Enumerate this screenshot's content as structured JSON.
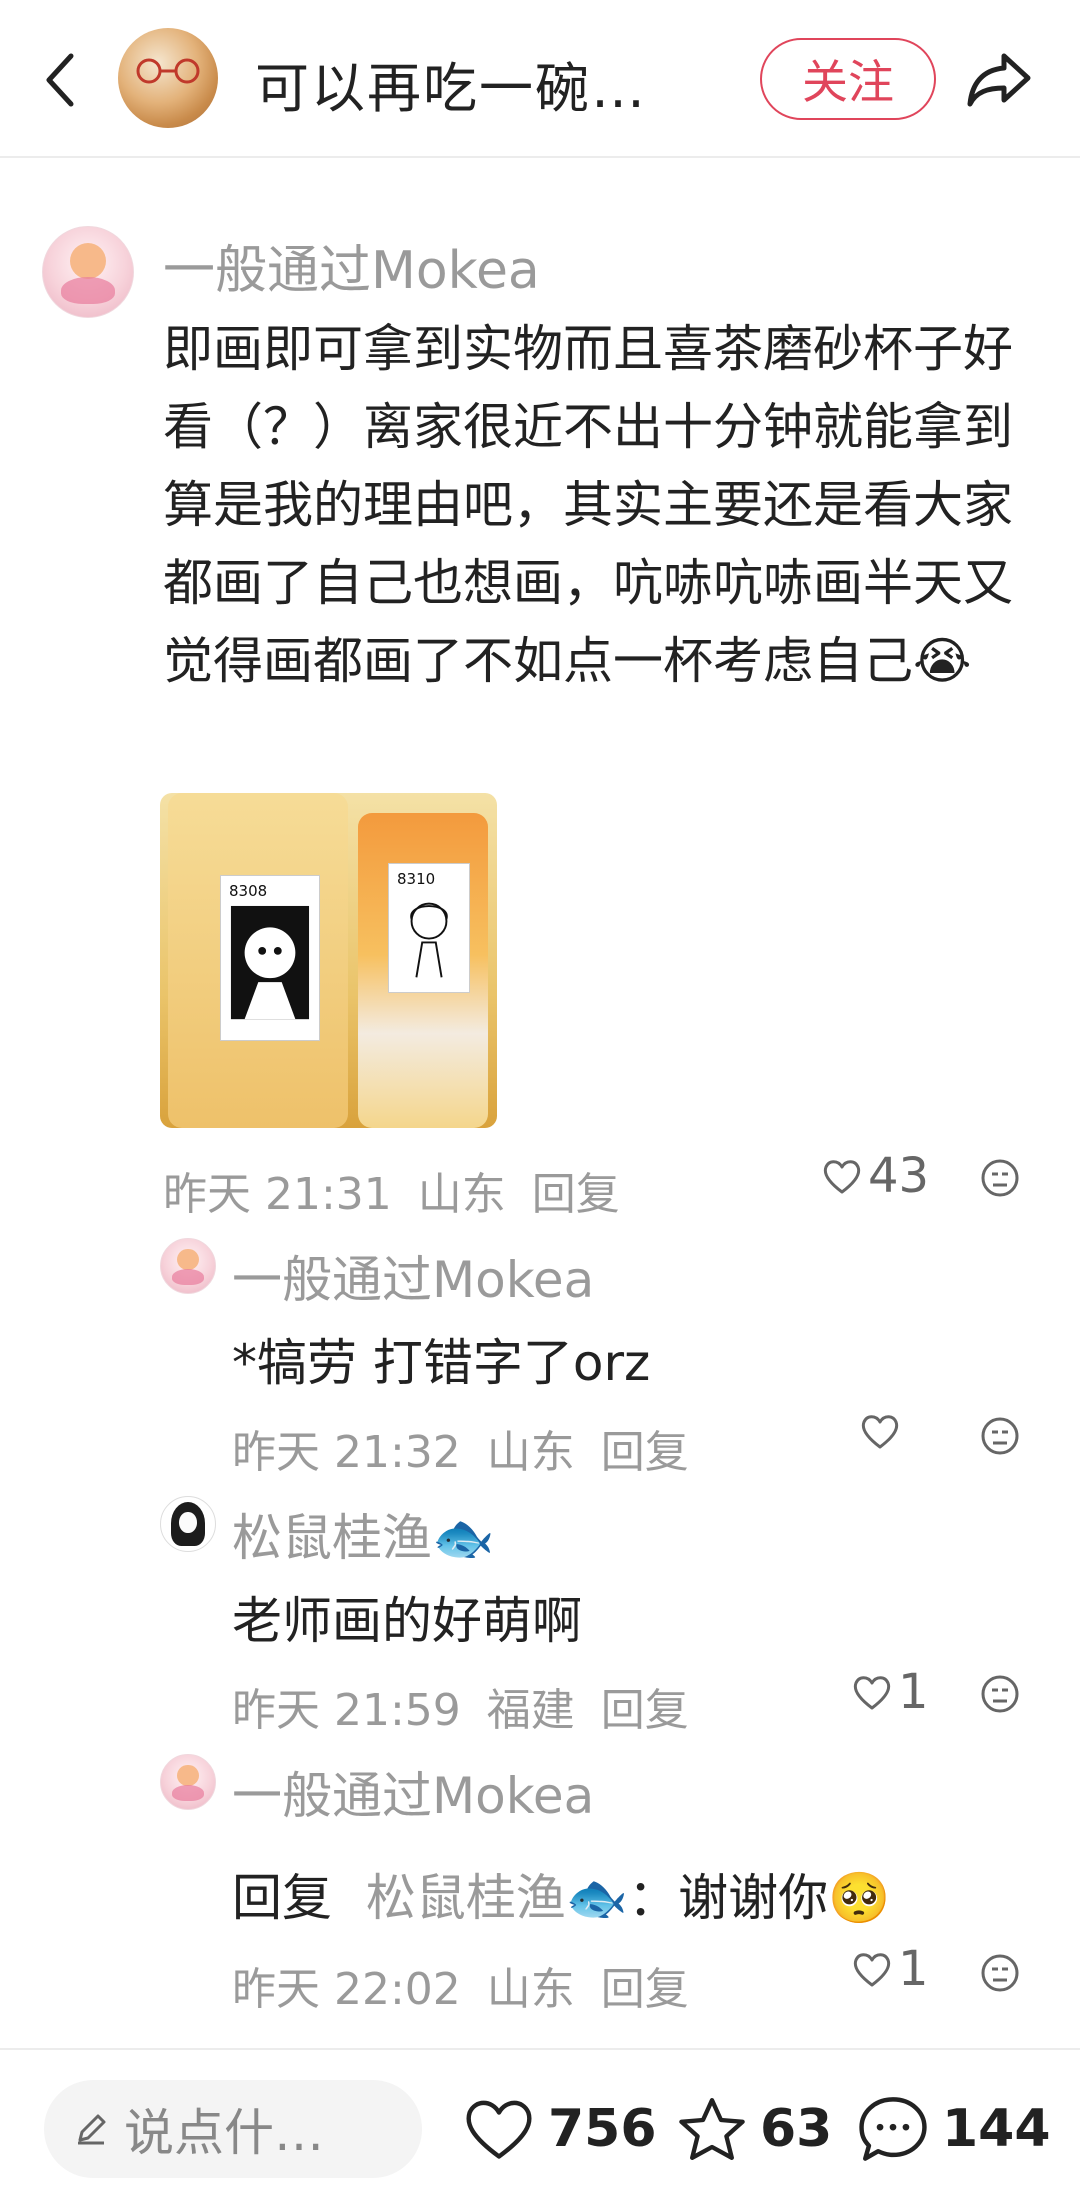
{
  "header": {
    "author_name": "可以再吃一碗…",
    "follow_label": "关注"
  },
  "comments": [
    {
      "username": "一般通过Mokea",
      "text": "即画即可拿到实物而且喜茶磨砂杯子好看（？）离家很近不出十分钟就能拿到算是我的理由吧，其实主要还是看大家都画了自己也想画，吭哧吭哧画半天又觉得画都画了不如点一杯考虑自己😭",
      "photo_labels": [
        "8308",
        "8310"
      ],
      "time": "昨天 21:31",
      "location": "山东",
      "reply_label": "回复",
      "likes": "43"
    },
    {
      "username": "一般通过Mokea",
      "text": "*犒劳 打错字了orz",
      "time": "昨天 21:32",
      "location": "山东",
      "reply_label": "回复",
      "likes": ""
    },
    {
      "username": "松鼠桂渔🐟",
      "text": "老师画的好萌啊",
      "time": "昨天 21:59",
      "location": "福建",
      "reply_label": "回复",
      "likes": "1"
    },
    {
      "username": "一般通过Mokea",
      "reply_prefix": "回复",
      "reply_to": "松鼠桂渔🐟",
      "reply_sep": "：",
      "text": "谢谢你🥺",
      "time": "昨天 22:02",
      "location": "山东",
      "reply_label": "回复",
      "likes": "1"
    }
  ],
  "bottom_bar": {
    "input_placeholder": "说点什…",
    "likes_count": "756",
    "stars_count": "63",
    "comments_count": "144"
  },
  "colors": {
    "accent": "#e0455b",
    "muted_text": "#9a9a9a"
  },
  "icons": [
    "back-icon",
    "share-icon",
    "heart-icon",
    "star-icon",
    "comment-bubble-icon",
    "dislike-icon",
    "pencil-icon"
  ]
}
